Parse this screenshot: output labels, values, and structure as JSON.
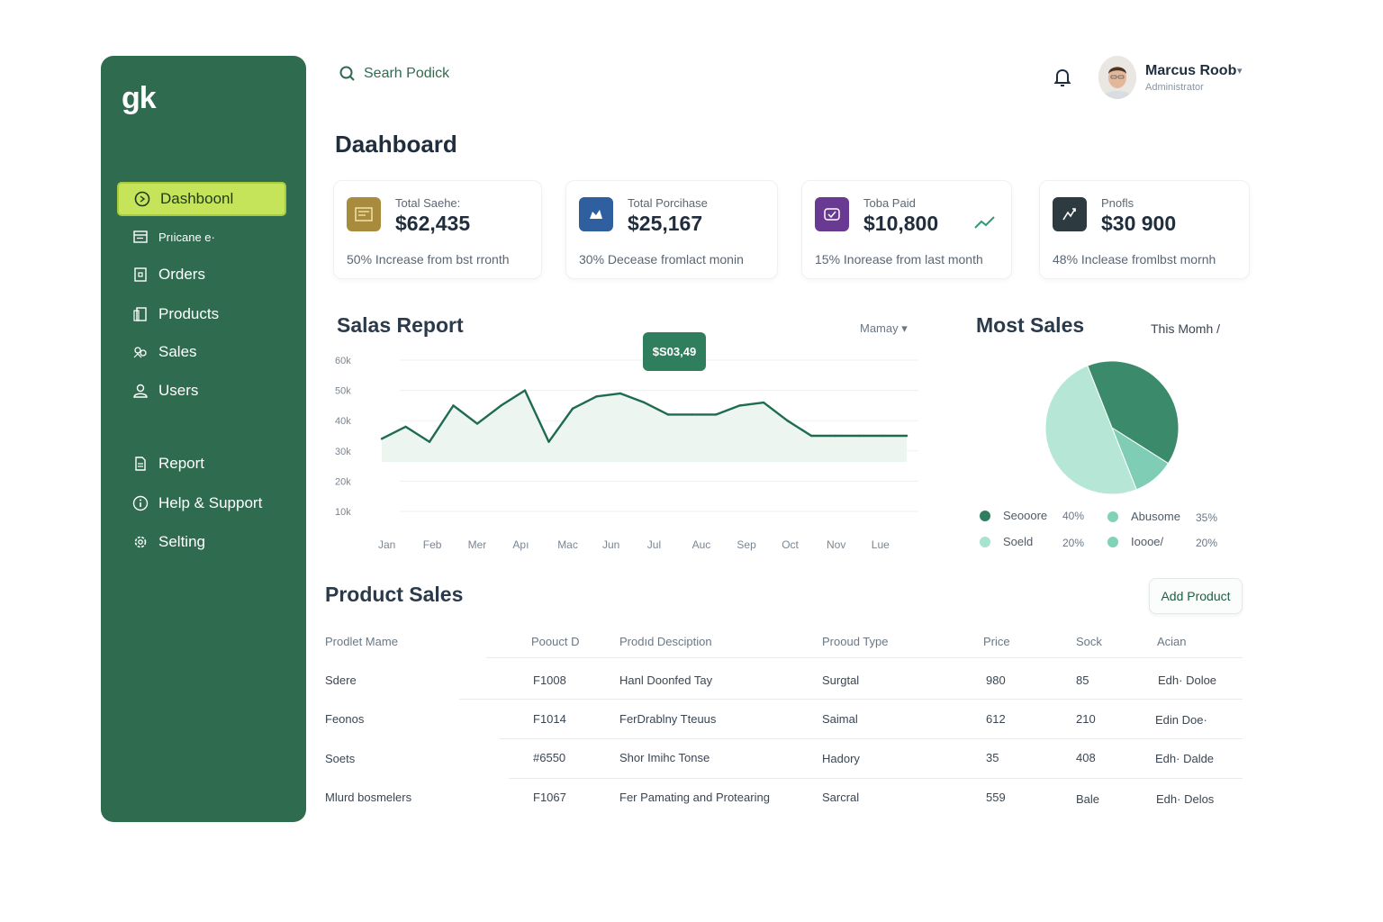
{
  "app": {
    "logo": "gk"
  },
  "sidebar": {
    "items": [
      {
        "label": "Dashboonl",
        "icon": "dashboard-icon",
        "active": true
      },
      {
        "label": "Prıicane e·",
        "icon": "purchase-icon"
      },
      {
        "label": "Orders",
        "icon": "orders-icon"
      },
      {
        "label": "Products",
        "icon": "products-icon"
      },
      {
        "label": "Sales",
        "icon": "sales-icon"
      },
      {
        "label": "Users",
        "icon": "user-icon"
      },
      {
        "label": "Report",
        "icon": "report-icon"
      },
      {
        "label": "Help & Support",
        "icon": "info-icon"
      },
      {
        "label": "Selting",
        "icon": "gear-icon"
      }
    ]
  },
  "header": {
    "search_placeholder": "Searh Podick",
    "user_name": "Marcus Roob",
    "user_role": "Administrator"
  },
  "page_title": "Daahboard",
  "cards": [
    {
      "label": "Total Saehe:",
      "value": "$62,435",
      "note": "50% Increase from bst rronth",
      "icon": "sales-box-icon",
      "color": "#a88b3c"
    },
    {
      "label": "Total Porcihase",
      "value": "$25,167",
      "note": "30% Decease fromlact monin",
      "icon": "purchase-box-icon",
      "color": "#2f5f9e"
    },
    {
      "label": "Toba Paid",
      "value": "$10,800",
      "note": "15% Inorease from last month",
      "icon": "paid-box-icon",
      "color": "#6a3a93"
    },
    {
      "label": "Pnofls",
      "value": "$30 900",
      "note": "48% Inclease fromlbst mornh",
      "icon": "profit-box-icon",
      "color": "#2d3a40"
    }
  ],
  "sales_report": {
    "title": "Salas Report",
    "filter": "Mamay",
    "tooltip": "$S03,49"
  },
  "most_sales": {
    "title": "Most Sales",
    "filter": "This Momh",
    "legend": [
      {
        "label": "Seooore",
        "pct": "40%",
        "color": "#2f7f5f"
      },
      {
        "label": "Abusome",
        "pct": "35%",
        "color": "#7fd3b8"
      },
      {
        "label": "Soeld",
        "pct": "20%",
        "color": "#a7e3cf"
      },
      {
        "label": "Ioooe/",
        "pct": "20%",
        "color": "#7fd3b8"
      }
    ]
  },
  "chart_data": [
    {
      "type": "area",
      "title": "Salas Report",
      "categories": [
        "Jan",
        "Feb",
        "Mer",
        "Apı",
        "Mac",
        "Jun",
        "Jul",
        "Auc",
        "Sep",
        "Oct",
        "Nov",
        "Lue"
      ],
      "yticks": [
        "60k",
        "50k",
        "40k",
        "30k",
        "20k",
        "10k"
      ],
      "x": [
        0,
        0.5,
        1,
        1.5,
        2,
        2.5,
        3,
        3.5,
        4,
        4.5,
        5,
        5.5,
        6,
        6.5,
        7,
        7.5,
        8,
        8.5,
        9,
        9.5,
        10,
        10.5,
        11
      ],
      "values": [
        34,
        38,
        33,
        45,
        39,
        45,
        50,
        33,
        44,
        48,
        49,
        46,
        42,
        42,
        42,
        45,
        46,
        40,
        35,
        35,
        35,
        35,
        35
      ],
      "ylim": [
        10,
        60
      ],
      "grid": true
    },
    {
      "type": "pie",
      "title": "Most Sales",
      "labels": [
        "Seooore",
        "Abusome",
        "Soeld"
      ],
      "values": [
        40,
        10,
        50
      ],
      "colors": [
        "#3c8a6c",
        "#7ecdb4",
        "#b6e6d6"
      ]
    }
  ],
  "product_sales": {
    "title": "Product Sales",
    "add_button": "Add Product",
    "columns": [
      "Prodlet Mame",
      "Poouct D",
      "Prodıd Desciption",
      "Prooud Type",
      "Price",
      "Sock",
      "Acian"
    ],
    "rows": [
      [
        "Sdere",
        "F1008",
        "Hanl Doonfed Tay",
        "Surgtal",
        "980",
        "85",
        "Edh· Doloe"
      ],
      [
        "Feonos",
        "F1014",
        "FerDrablny Tteuus",
        "Saimal",
        "612",
        "210",
        "Edin Doe·"
      ],
      [
        "Soets",
        "#6550",
        "Shor Imihc Tonse",
        "Hadory",
        "35",
        "408",
        "Edh· Dalde"
      ],
      [
        "Mlurd bosmelers",
        "F1067",
        "Fer Pamating and Protearing",
        "Sarcral",
        "559",
        "Bale",
        "Edh· Delos"
      ]
    ]
  }
}
